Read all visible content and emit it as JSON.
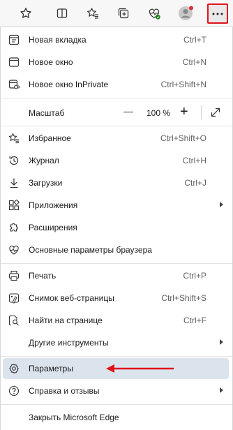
{
  "toolbar": {
    "icons": [
      "star-icon",
      "split-screen-icon",
      "favorites-icon",
      "collections-icon",
      "browser-essentials-icon",
      "profile-icon",
      "more-icon"
    ]
  },
  "menu": {
    "new_tab": {
      "label": "Новая вкладка",
      "shortcut": "Ctrl+T"
    },
    "new_window": {
      "label": "Новое окно",
      "shortcut": "Ctrl+N"
    },
    "new_inprivate": {
      "label": "Новое окно InPrivate",
      "shortcut": "Ctrl+Shift+N"
    },
    "zoom": {
      "label": "Масштаб",
      "minus": "—",
      "value": "100 %",
      "plus": "+"
    },
    "favorites": {
      "label": "Избранное",
      "shortcut": "Ctrl+Shift+O"
    },
    "history": {
      "label": "Журнал",
      "shortcut": "Ctrl+H"
    },
    "downloads": {
      "label": "Загрузки",
      "shortcut": "Ctrl+J"
    },
    "apps": {
      "label": "Приложения"
    },
    "extensions": {
      "label": "Расширения"
    },
    "browser_essentials": {
      "label": "Основные параметры браузера"
    },
    "print": {
      "label": "Печать",
      "shortcut": "Ctrl+P"
    },
    "web_capture": {
      "label": "Снимок веб-страницы",
      "shortcut": "Ctrl+Shift+S"
    },
    "find": {
      "label": "Найти на странице",
      "shortcut": "Ctrl+F"
    },
    "more_tools": {
      "label": "Другие инструменты"
    },
    "settings": {
      "label": "Параметры"
    },
    "help": {
      "label": "Справка и отзывы"
    },
    "close": {
      "label": "Закрыть Microsoft Edge"
    }
  },
  "colors": {
    "highlight": "#dbe3ed",
    "annotation_arrow": "#e0121b",
    "profile_badge": "#d13438",
    "essentials_badge": "#107c10"
  }
}
